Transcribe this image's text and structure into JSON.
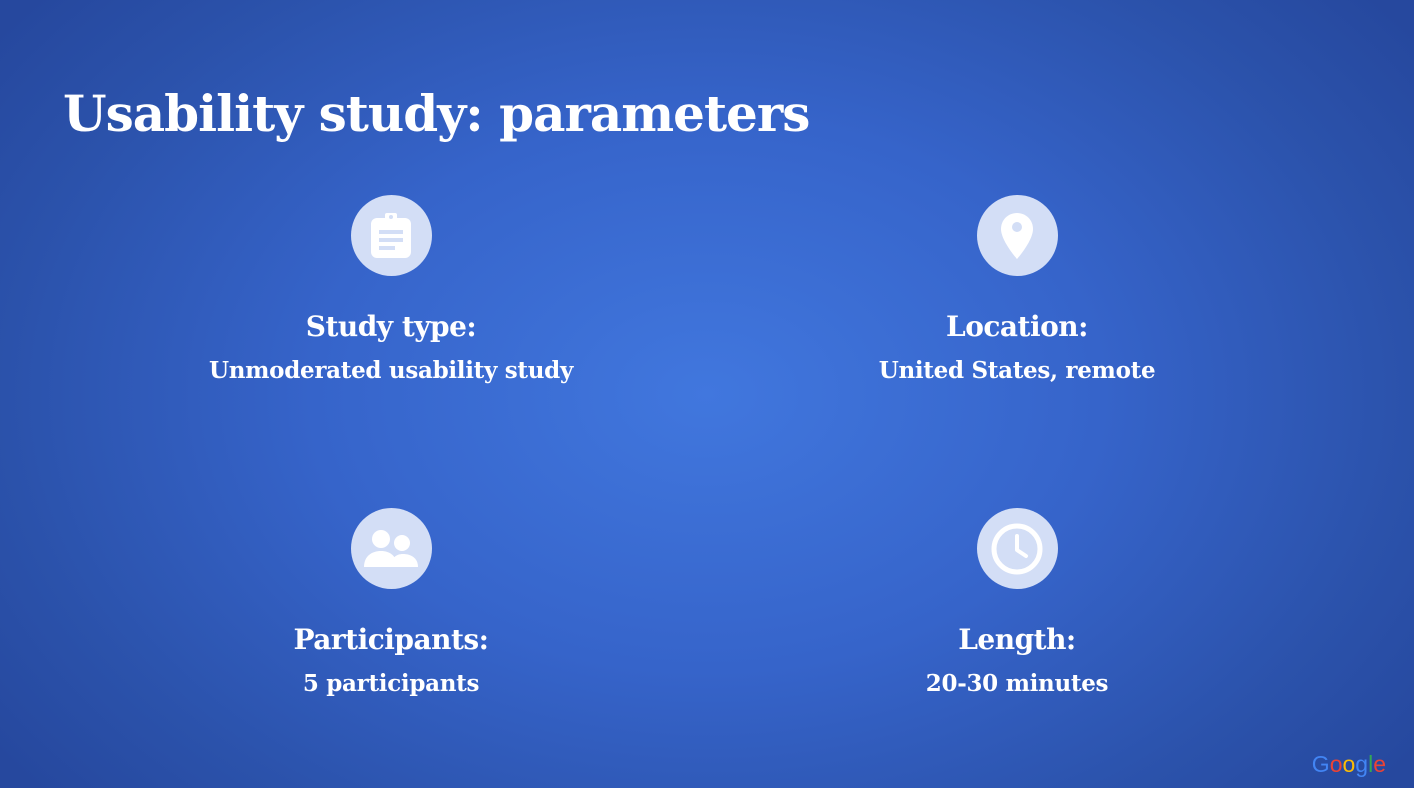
{
  "slide": {
    "title": "Usability study: parameters"
  },
  "items": [
    {
      "icon": "clipboard-icon",
      "label": "Study type:",
      "value": "Unmoderated usability study"
    },
    {
      "icon": "location-pin-icon",
      "label": "Location:",
      "value": "United States, remote"
    },
    {
      "icon": "people-icon",
      "label": "Participants:",
      "value": "5 participants"
    },
    {
      "icon": "clock-icon",
      "label": "Length:",
      "value": "20-30 minutes"
    }
  ],
  "logo": {
    "letters": [
      "G",
      "o",
      "o",
      "g",
      "l",
      "e"
    ],
    "colors": [
      "#4285F4",
      "#EA4335",
      "#FBBC05",
      "#4285F4",
      "#34A853",
      "#EA4335"
    ]
  },
  "colors": {
    "background_center": "#4177de",
    "background_edge": "#26489e",
    "icon_circle": "#d3def6",
    "text": "#ffffff"
  }
}
